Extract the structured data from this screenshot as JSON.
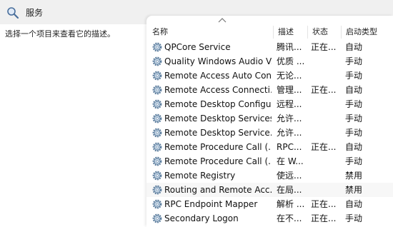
{
  "window": {
    "title": "服务"
  },
  "left_pane": {
    "description": "选择一个项目来查看它的描述。"
  },
  "table": {
    "columns": {
      "name": "名称",
      "description": "描述",
      "status": "状态",
      "startup": "启动类型"
    },
    "rows": [
      {
        "name": "QPCore Service",
        "description": "腾讯...",
        "status": "正在...",
        "startup": "自动"
      },
      {
        "name": "Quality Windows Audio V...",
        "description": "优质 ...",
        "status": "",
        "startup": "手动"
      },
      {
        "name": "Remote Access Auto Con...",
        "description": "无论...",
        "status": "",
        "startup": "手动"
      },
      {
        "name": "Remote Access Connecti...",
        "description": "管理...",
        "status": "正在...",
        "startup": "自动"
      },
      {
        "name": "Remote Desktop Configu...",
        "description": "远程...",
        "status": "",
        "startup": "手动"
      },
      {
        "name": "Remote Desktop Services",
        "description": "允许...",
        "status": "",
        "startup": "手动"
      },
      {
        "name": "Remote Desktop Service...",
        "description": "允许...",
        "status": "",
        "startup": "手动"
      },
      {
        "name": "Remote Procedure Call (...",
        "description": "RPC...",
        "status": "正在...",
        "startup": "自动"
      },
      {
        "name": "Remote Procedure Call (...",
        "description": "在 W...",
        "status": "",
        "startup": "手动"
      },
      {
        "name": "Remote Registry",
        "description": "使远...",
        "status": "",
        "startup": "禁用"
      },
      {
        "name": "Routing and Remote Acc...",
        "description": "在局...",
        "status": "",
        "startup": "禁用"
      },
      {
        "name": "RPC Endpoint Mapper",
        "description": "解析 ...",
        "status": "正在...",
        "startup": "自动"
      },
      {
        "name": "Secondary Logon",
        "description": "在不...",
        "status": "正在...",
        "startup": "手动"
      }
    ]
  },
  "icons": {
    "header": "magnifier-icon",
    "service": "gear-icon",
    "sort": "sort-ascending-icon"
  }
}
